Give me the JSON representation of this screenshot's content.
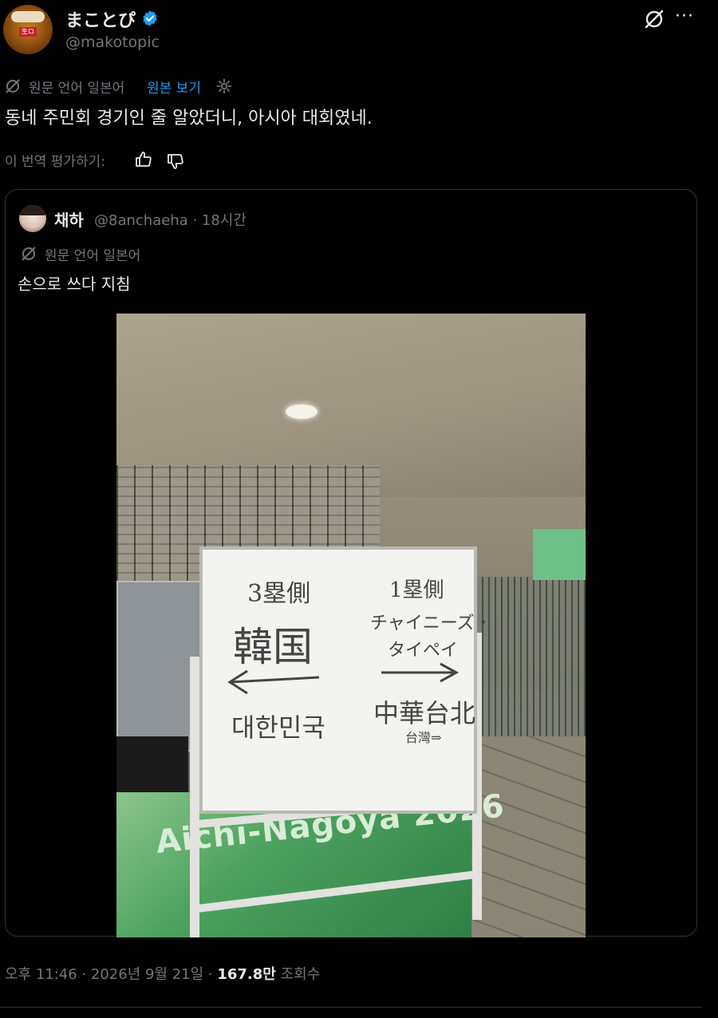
{
  "author": {
    "name": "まことぴ",
    "handle": "@makotopic",
    "avatar_label": "生ロ"
  },
  "translation": {
    "source_lang_label": "원문 언어 일본어",
    "show_original_label": "원본 보기"
  },
  "tweet_text": "동네 주민회 경기인 줄 알았더니, 아시아 대회였네.",
  "rate_translation_label": "이 번역 평가하기:",
  "quoted": {
    "name": "채하",
    "handle_time": "@8anchaeha · 18시간",
    "source_lang_label": "원문 언어 일본어",
    "text": "손으로 쓰다 지침",
    "board": {
      "left_header": "3塁側",
      "left_country": "韓国",
      "left_korean": "대한민국",
      "right_header": "1塁側",
      "right_line1": "チャイニーズ・",
      "right_line2": "タイペイ",
      "right_kanji": "中華台北",
      "right_small": "台灣⇒",
      "banner": "Aichi-Nagoya 2026"
    }
  },
  "footer": {
    "time": "오후 11:46 · 2026년 9월 21일 · ",
    "views": "167.8만",
    "views_label": " 조회수"
  },
  "colors": {
    "background": "#000000",
    "link": "#1d9bf0",
    "muted": "#71767b",
    "verified": "#1d9bf0"
  }
}
